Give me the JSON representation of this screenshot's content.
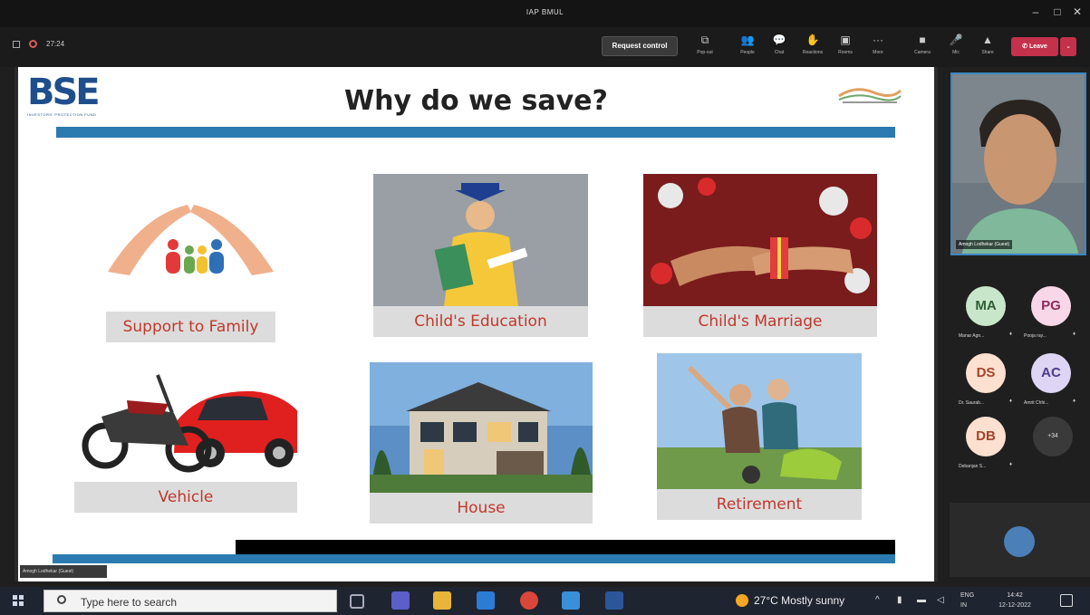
{
  "window": {
    "title": "IAP BMUL"
  },
  "meeting": {
    "timer": "27:24",
    "request_control": "Request control",
    "tools": [
      {
        "label": "Pop-out",
        "icon": "pop-out-icon"
      },
      {
        "label": "People",
        "icon": "people-icon"
      },
      {
        "label": "Chat",
        "icon": "chat-icon"
      },
      {
        "label": "Reactions",
        "icon": "reactions-icon"
      },
      {
        "label": "Rooms",
        "icon": "rooms-icon"
      },
      {
        "label": "More",
        "icon": "more-icon"
      },
      {
        "label": "Camera",
        "icon": "camera-icon"
      },
      {
        "label": "Mic",
        "icon": "mic-icon"
      },
      {
        "label": "Share",
        "icon": "share-icon"
      }
    ],
    "leave": "Leave"
  },
  "slide": {
    "logo": "BSE",
    "logo_tagline": "INVESTORS' PROTECTION FUND",
    "title": "Why do we save?",
    "tiles": [
      {
        "caption": "Support to Family"
      },
      {
        "caption": "Child's Education"
      },
      {
        "caption": "Child's Marriage"
      },
      {
        "caption": "Vehicle"
      },
      {
        "caption": "House"
      },
      {
        "caption": "Retirement"
      }
    ],
    "presenter_label": "Amogh Lodhekar (Guest)"
  },
  "participants": {
    "speaker": "Amogh Lodhekar (Guest)",
    "people": [
      {
        "initials": "MA",
        "name": "Manar Agn...",
        "color": "#c8e6c9"
      },
      {
        "initials": "PG",
        "name": "Pooja ray...",
        "color": "#f8d7e8"
      },
      {
        "initials": "DS",
        "name": "Dr. Saurab...",
        "color": "#fde0cf"
      },
      {
        "initials": "AC",
        "name": "Amrit Chhi...",
        "color": "#ddd5f3"
      },
      {
        "initials": "DB",
        "name": "Debanjan S...",
        "color": "#fde0cf"
      }
    ],
    "more_count": "+34"
  },
  "taskbar": {
    "search_placeholder": "Type here to search",
    "weather": "27°C  Mostly sunny",
    "lang_line1": "ENG",
    "lang_line2": "IN",
    "time": "14:42",
    "date": "12-12-2022"
  }
}
